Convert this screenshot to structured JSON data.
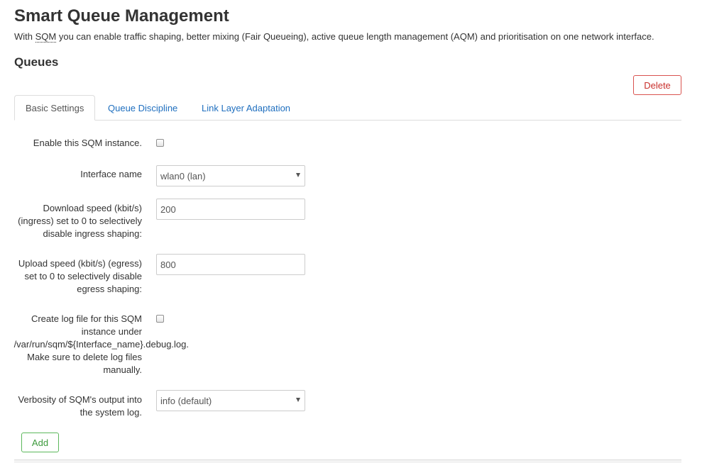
{
  "page": {
    "title": "Smart Queue Management",
    "description": {
      "prefix": "With ",
      "abbr": "SQM",
      "suffix": " you can enable traffic shaping, better mixing (Fair Queueing), active queue length management (AQM) and prioritisation on one network interface."
    }
  },
  "section": {
    "title": "Queues",
    "delete_label": "Delete",
    "add_label": "Add"
  },
  "tabs": [
    {
      "label": "Basic Settings",
      "active": true
    },
    {
      "label": "Queue Discipline",
      "active": false
    },
    {
      "label": "Link Layer Adaptation",
      "active": false
    }
  ],
  "form": {
    "enable": {
      "label": "Enable this SQM instance.",
      "checked": false
    },
    "interface": {
      "label": "Interface name",
      "value": "wlan0 (lan)"
    },
    "download": {
      "label_lines": [
        "Download speed (kbit/s)",
        "(ingress) set to 0 to selectively",
        "disable ingress shaping:"
      ],
      "value": "200"
    },
    "upload": {
      "label_lines": [
        "Upload speed (kbit/s) (egress)",
        "set to 0 to selectively disable",
        "egress shaping:"
      ],
      "value": "800"
    },
    "logfile": {
      "label_lines": [
        "Create log file for this SQM",
        "instance under",
        "/var/run/sqm/${Interface_name}.debug.log.",
        "Make sure to delete log files",
        "manually."
      ],
      "checked": false
    },
    "verbosity": {
      "label_lines": [
        "Verbosity of SQM's output into",
        "the system log."
      ],
      "value": "info (default)"
    }
  }
}
